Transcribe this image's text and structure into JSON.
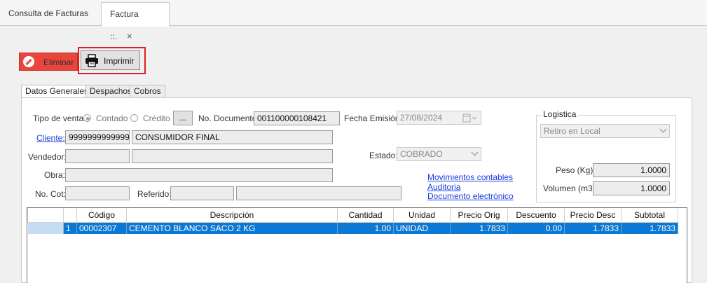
{
  "tabs": [
    {
      "label": "Consulta de Facturas"
    },
    {
      "label": "Factura ::.",
      "close": "×"
    }
  ],
  "toolbar": {
    "delete_label": "Eliminar",
    "print_label": "Imprimir"
  },
  "form_tabs": [
    {
      "label": "Datos Generales"
    },
    {
      "label": "Despachos"
    },
    {
      "label": "Cobros"
    }
  ],
  "form": {
    "tipo_venta_label": "Tipo de venta:",
    "contado_label": "Contado",
    "credito_label": "Crédito",
    "dots_label": "...",
    "no_documento_label": "No. Documento:",
    "no_documento_value": "001100000108421",
    "fecha_emision_label": "Fecha Emisión:",
    "fecha_emision_value": "27/08/2024",
    "cliente_label": "Cliente:",
    "cliente_code": "9999999999999",
    "cliente_name": "CONSUMIDOR FINAL",
    "vendedor_label": "Vendedor:",
    "estado_label": "Estado:",
    "estado_value": "COBRADO",
    "obra_label": "Obra:",
    "no_cot_label": "No. Cot:",
    "referido_label": "Referido:",
    "links": {
      "movimientos": "Movimientos contables",
      "auditoria": "Auditoria",
      "documento": "Documento electrónico"
    }
  },
  "logistica": {
    "title": "Logistica",
    "mode_value": "Retiro en Local",
    "peso_label": "Peso (Kg):",
    "peso_value": "1.0000",
    "volumen_label": "Volumen (m3):",
    "volumen_value": "1.0000"
  },
  "grid": {
    "columns": [
      "",
      "",
      "Código",
      "Descripción",
      "Cantidad",
      "Unidad",
      "Precio Orig",
      "Descuento",
      "Precio Desc",
      "Subtotal"
    ],
    "rows": [
      {
        "num": "1",
        "codigo": "00002307",
        "descripcion": "CEMENTO BLANCO SACO 2 KG",
        "cantidad": "1.00",
        "unidad": "UNIDAD",
        "precio_orig": "1.7833",
        "descuento": "0.00",
        "precio_desc": "1.7833",
        "subtotal": "1.7833"
      }
    ]
  },
  "colors": {
    "accent": "#0a78d4",
    "delete": "#e8463d",
    "highlight": "#e02020"
  }
}
